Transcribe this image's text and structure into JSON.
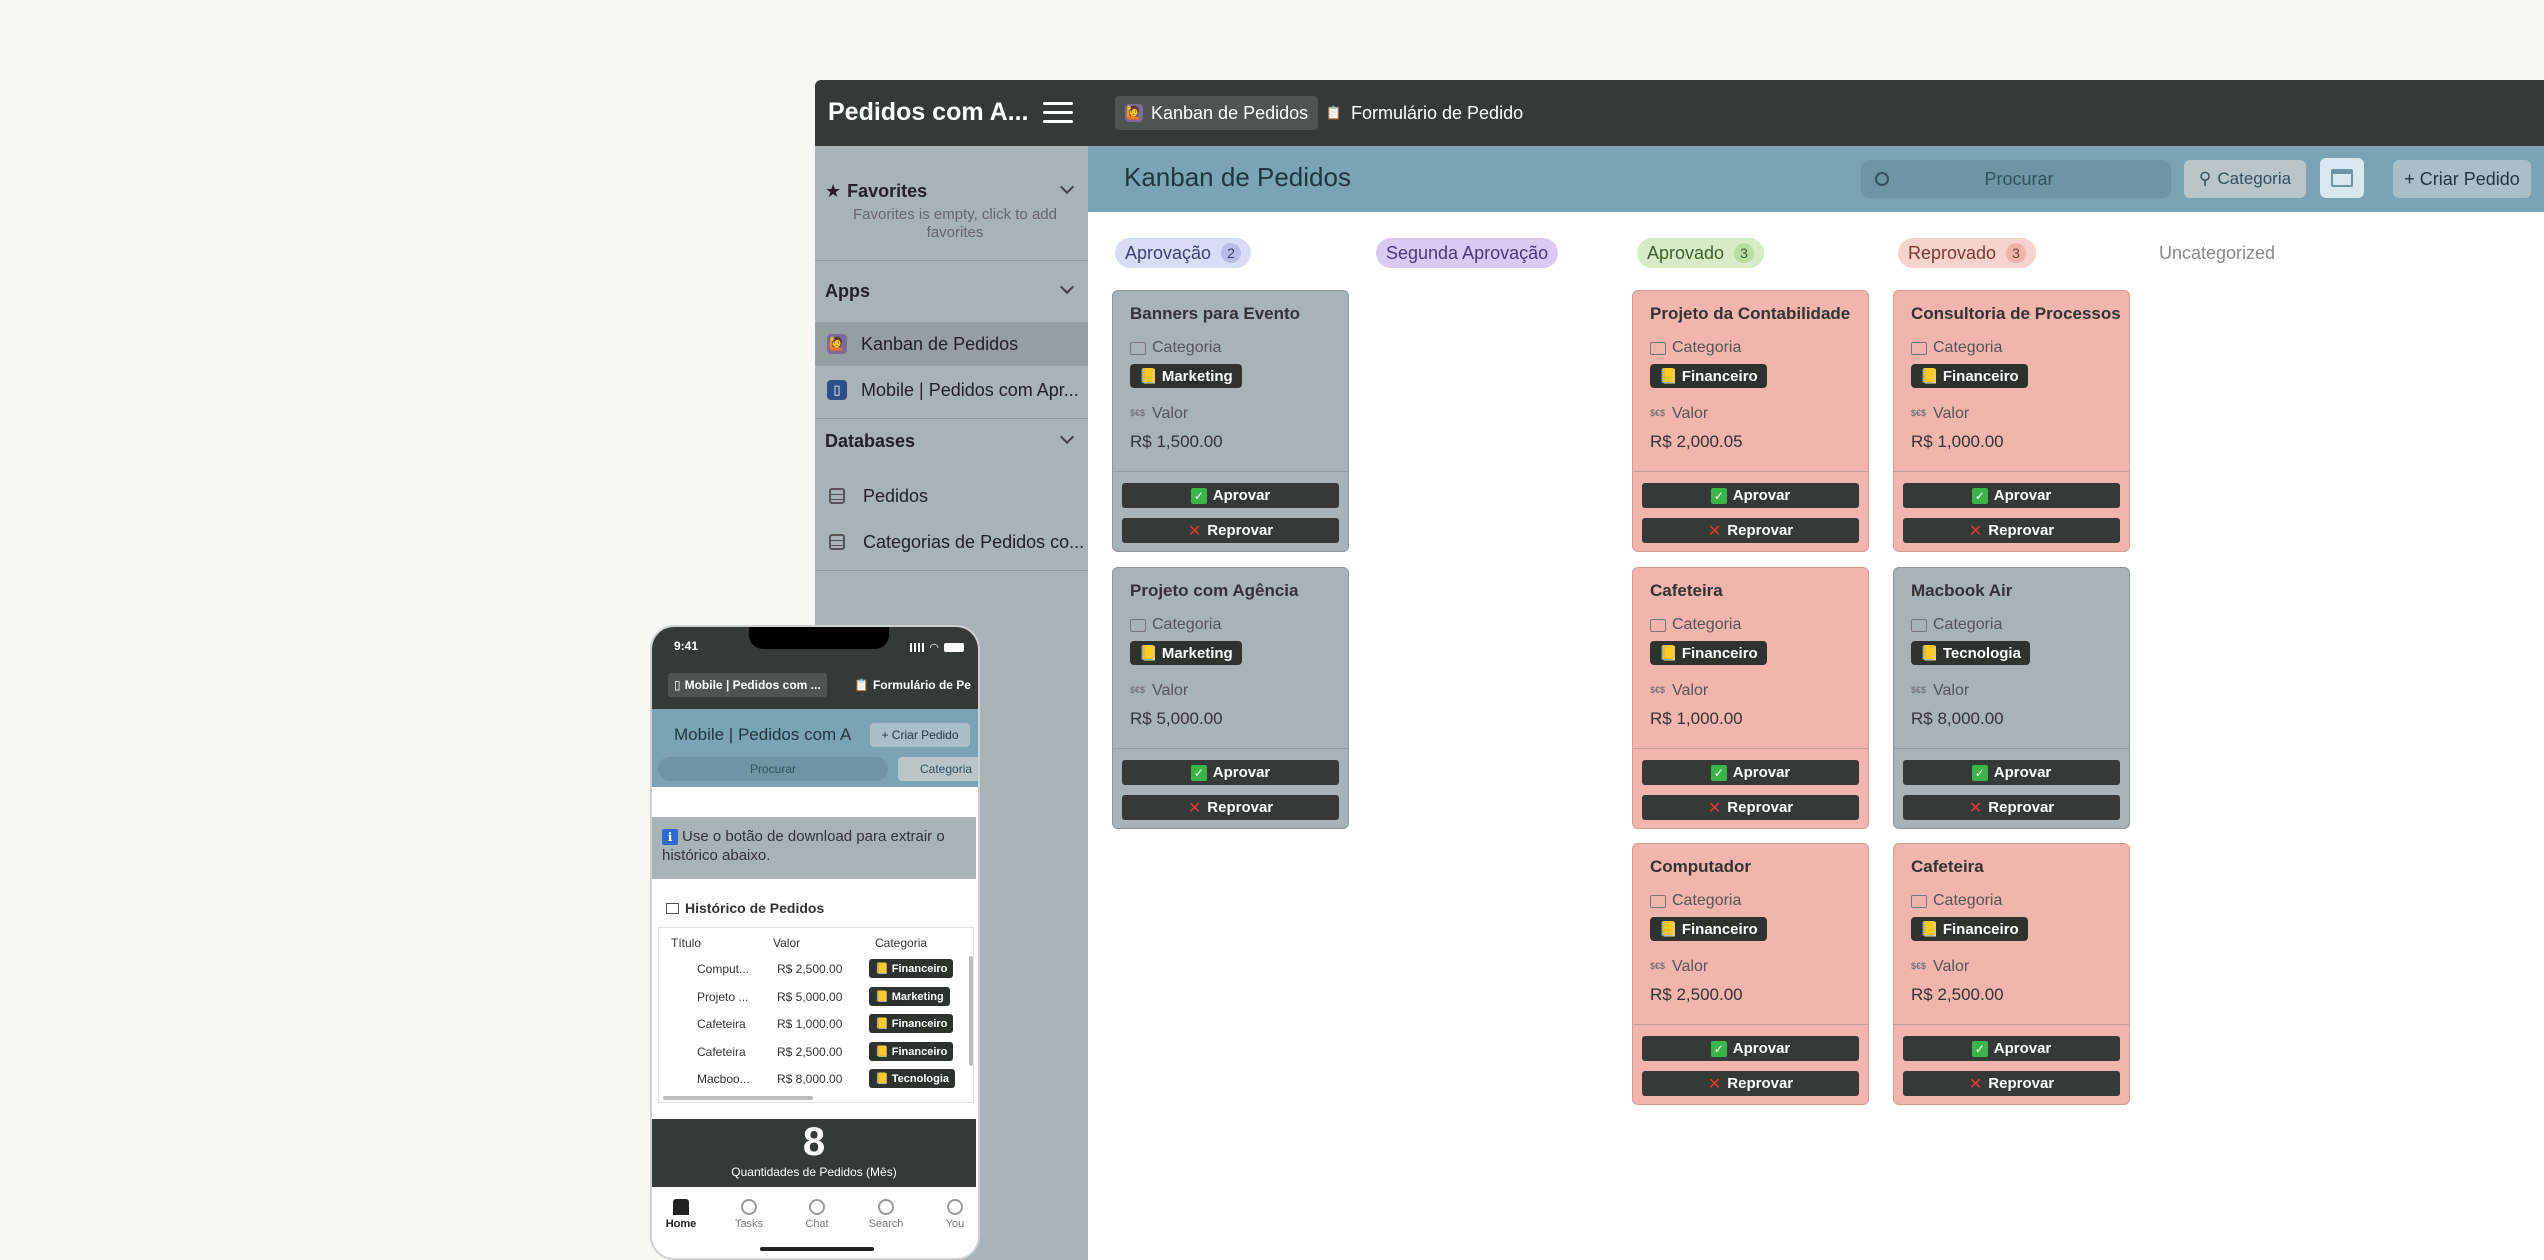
{
  "app": {
    "title": "Pedidos com A...",
    "tabs": [
      {
        "label": "Kanban de Pedidos",
        "icon": "kanban-app-icon"
      },
      {
        "label": "Formulário de Pedido",
        "icon": "clipboard-icon"
      }
    ]
  },
  "sidebar": {
    "favorites_label": "Favorites",
    "favorites_empty": "Favorites is empty, click to add favorites",
    "apps_label": "Apps",
    "apps": [
      {
        "label": "Kanban de Pedidos"
      },
      {
        "label": "Mobile | Pedidos com Apr..."
      }
    ],
    "databases_label": "Databases",
    "databases": [
      {
        "label": "Pedidos"
      },
      {
        "label": "Categorias de Pedidos co..."
      }
    ]
  },
  "header": {
    "title": "Kanban de Pedidos",
    "search_placeholder": "Procurar",
    "category_label": "Categoria",
    "create_label": "+ Criar Pedido"
  },
  "card_labels": {
    "category": "Categoria",
    "value": "Valor",
    "approve": "Aprovar",
    "reject": "Reprovar"
  },
  "columns": [
    {
      "label": "Aprovação",
      "count": "2",
      "color": "#d9dcf7"
    },
    {
      "label": "Segunda Aprovação",
      "count": "",
      "color": "#d9c9f3"
    },
    {
      "label": "Aprovado",
      "count": "3",
      "color": "#d6ecc6"
    },
    {
      "label": "Reprovado",
      "count": "3",
      "color": "#f6d2cd"
    },
    {
      "label": "Uncategorized",
      "count": "",
      "color": ""
    }
  ],
  "cards": [
    {
      "title": "Banners para Evento",
      "category": "📒 Marketing",
      "value": "R$ 1,500.00"
    },
    {
      "title": "Projeto com Agência",
      "category": "📒 Marketing",
      "value": "R$ 5,000.00"
    },
    {
      "title": "Projeto da Contabilidade",
      "category": "📒 Financeiro",
      "value": "R$ 2,000.05"
    },
    {
      "title": "Cafeteira",
      "category": "📒 Financeiro",
      "value": "R$ 1,000.00"
    },
    {
      "title": "Computador",
      "category": "📒 Financeiro",
      "value": "R$ 2,500.00"
    },
    {
      "title": "Consultoria de Processos",
      "category": "📒 Financeiro",
      "value": "R$ 1,000.00"
    },
    {
      "title": "Macbook Air",
      "category": "📒 Tecnologia",
      "value": "R$ 8,000.00"
    },
    {
      "title": "Cafeteira",
      "category": "📒 Financeiro",
      "value": "R$ 2,500.00"
    }
  ],
  "colors": {
    "topbar": "#353a38",
    "header": "#7aa3b4",
    "sidebar": "#a7b3b5",
    "card_red": "#f1b5ad"
  },
  "phone": {
    "time": "9:41",
    "tabs": [
      {
        "label": "Mobile | Pedidos com ..."
      },
      {
        "label": "Formulário de Pe"
      }
    ],
    "title": "Mobile | Pedidos com A",
    "create_label": "+ Criar Pedido",
    "search_placeholder": "Procurar",
    "category_label": "Categoria",
    "info_text": "Use o botão de download para extrair o histórico abaixo.",
    "history_title": "Histórico de Pedidos",
    "table_headers": [
      "Título",
      "Valor",
      "Categoria"
    ],
    "table_rows": [
      {
        "title": "Comput...",
        "value": "R$ 2,500.00",
        "category": "📒 Financeiro"
      },
      {
        "title": "Projeto ...",
        "value": "R$ 5,000.00",
        "category": "📒 Marketing"
      },
      {
        "title": "Cafeteira",
        "value": "R$ 1,000.00",
        "category": "📒 Financeiro"
      },
      {
        "title": "Cafeteira",
        "value": "R$ 2,500.00",
        "category": "📒 Financeiro"
      },
      {
        "title": "Macboo...",
        "value": "R$ 8,000.00",
        "category": "📒 Tecnologia"
      }
    ],
    "stat_value": "8",
    "stat_label": "Quantidades de Pedidos (Mês)",
    "nav": [
      {
        "label": "Home",
        "icon": "home-icon"
      },
      {
        "label": "Tasks",
        "icon": "tasks-icon"
      },
      {
        "label": "Chat",
        "icon": "chat-icon"
      },
      {
        "label": "Search",
        "icon": "search-icon"
      },
      {
        "label": "You",
        "icon": "user-icon"
      }
    ]
  }
}
